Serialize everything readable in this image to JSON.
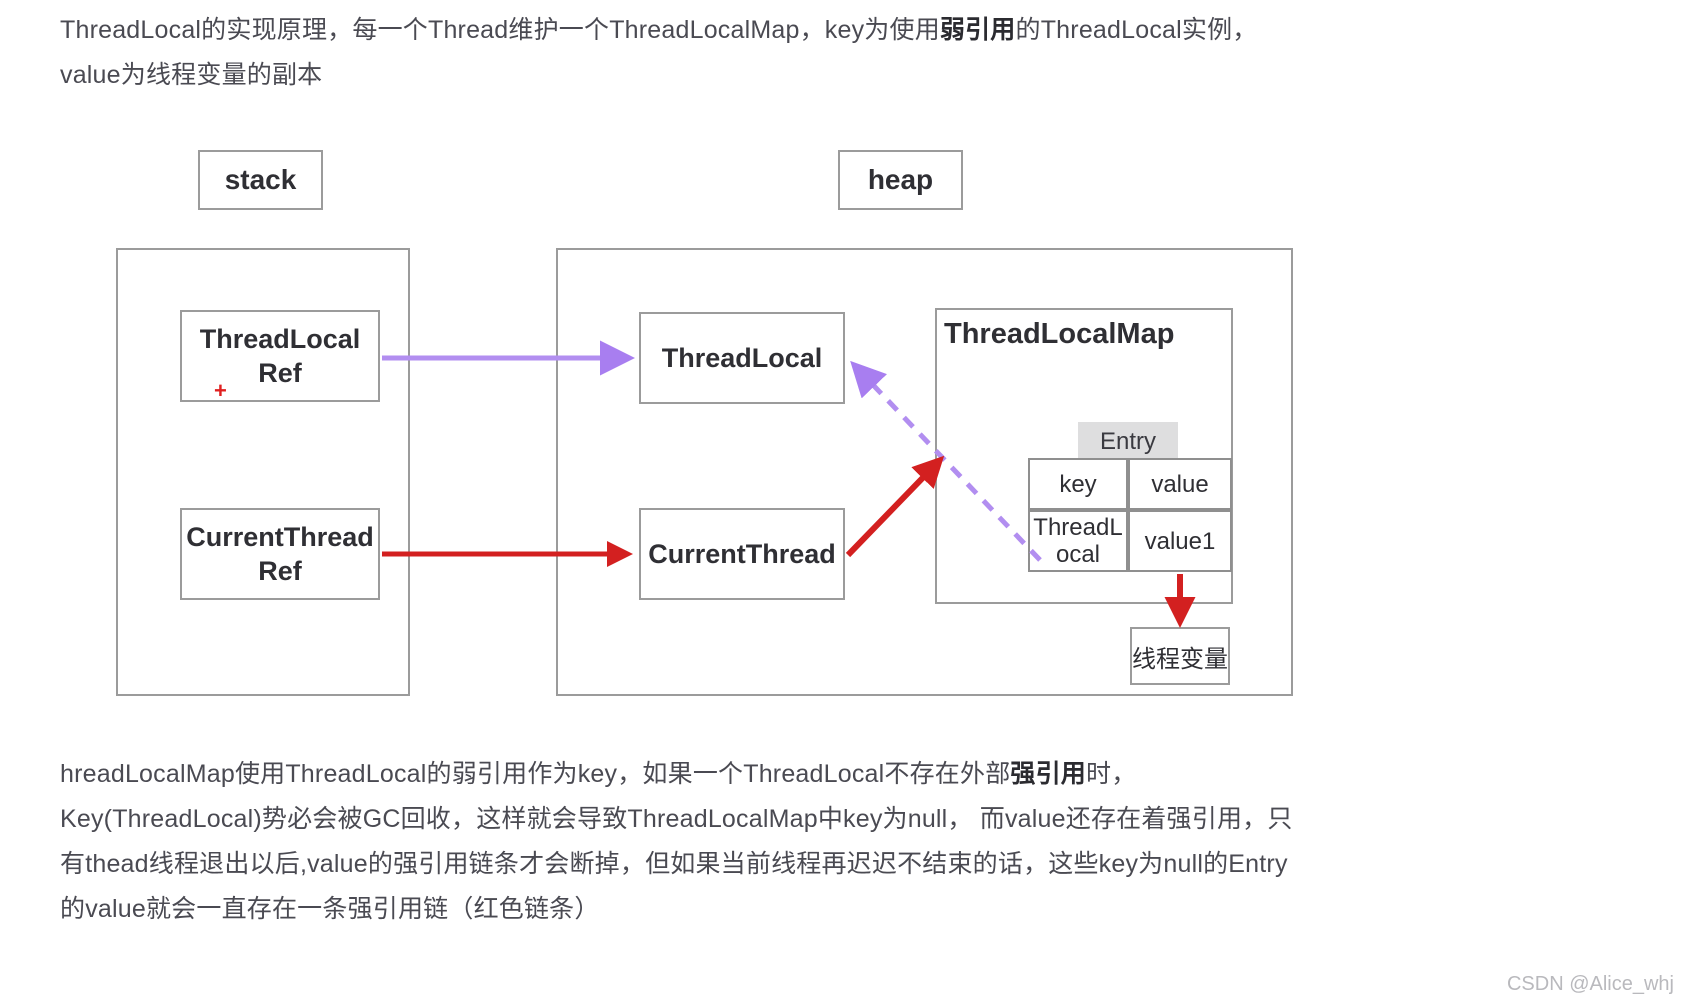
{
  "top_paragraph": {
    "line1_a": "ThreadLocal的实现原理，每一个Thread维护一个ThreadLocalMap，key为使用",
    "line1_b": "弱引用",
    "line1_c": "的ThreadLocal实例，",
    "line2": "value为线程变量的副本"
  },
  "diagram": {
    "stack_label": "stack",
    "heap_label": "heap",
    "threadlocal_ref": "ThreadLocal\nRef",
    "threadlocal_ref_line1": "ThreadLocal",
    "threadlocal_ref_line2": "Ref",
    "plus_marker": "+",
    "currentthread_ref_line1": "CurrentThread",
    "currentthread_ref_line2": "Ref",
    "threadlocal_obj": "ThreadLocal",
    "currentthread_obj": "CurrentThread",
    "map_title": "ThreadLocalMap",
    "entry_label": "Entry",
    "entry_table": {
      "headers": [
        "key",
        "value"
      ],
      "rows": [
        [
          "ThreadLocal",
          "value1"
        ]
      ],
      "key_cell_line1": "ThreadL",
      "key_cell_line2": "ocal",
      "value_cell": "value1"
    },
    "thread_variable_box": "线程变量",
    "colors": {
      "weak_ref_arrow": "#b28ef0",
      "strong_ref_arrow": "#d32020",
      "box_border": "#9b9b9b",
      "entry_header_bg": "#dededf"
    }
  },
  "bottom_paragraph": {
    "line1_a": "hreadLocalMap使用ThreadLocal的弱引用作为key，如果一个ThreadLocal不存在外部",
    "line1_b": "强引用",
    "line1_c": "时，",
    "line2": "Key(ThreadLocal)势必会被GC回收，这样就会导致ThreadLocalMap中key为null， 而value还存在着强引用，只",
    "line3": "有thead线程退出以后,value的强引用链条才会断掉，但如果当前线程再迟迟不结束的话，这些key为null的Entry",
    "line4": "的value就会一直存在一条强引用链（红色链条）"
  },
  "watermark": "CSDN @Alice_whj"
}
